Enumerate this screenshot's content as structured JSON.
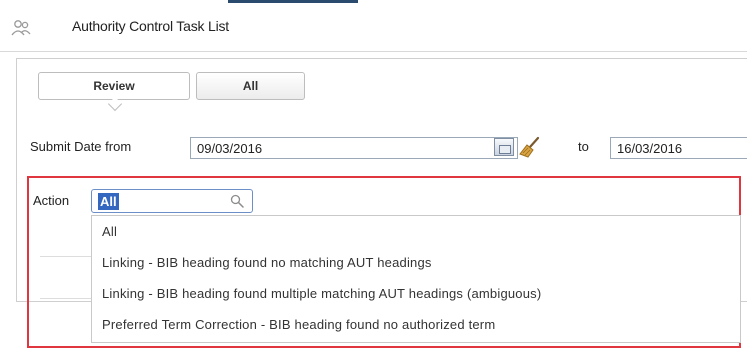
{
  "window": {
    "title": "Authority Control Task List",
    "app_icon": "people-icon"
  },
  "tabs": [
    {
      "label": "Review",
      "active": true
    },
    {
      "label": "All",
      "active": false
    }
  ],
  "filters": {
    "submit_date_label": "Submit Date from",
    "date_from": "09/03/2016",
    "to_label": "to",
    "date_to": "16/03/2016",
    "calendar_icon": "calendar-icon",
    "clear_icon": "broom-icon"
  },
  "action": {
    "label": "Action",
    "value": "All",
    "search_icon": "search-icon",
    "options": [
      "All",
      "Linking - BIB heading found no matching AUT headings",
      "Linking - BIB heading found multiple matching AUT headings (ambiguous)",
      "Preferred Term Correction - BIB heading found no authorized term"
    ]
  },
  "colors": {
    "highlight_border": "#e0363f",
    "selection": "#3367c0",
    "header_accent": "#2b4b6e"
  }
}
